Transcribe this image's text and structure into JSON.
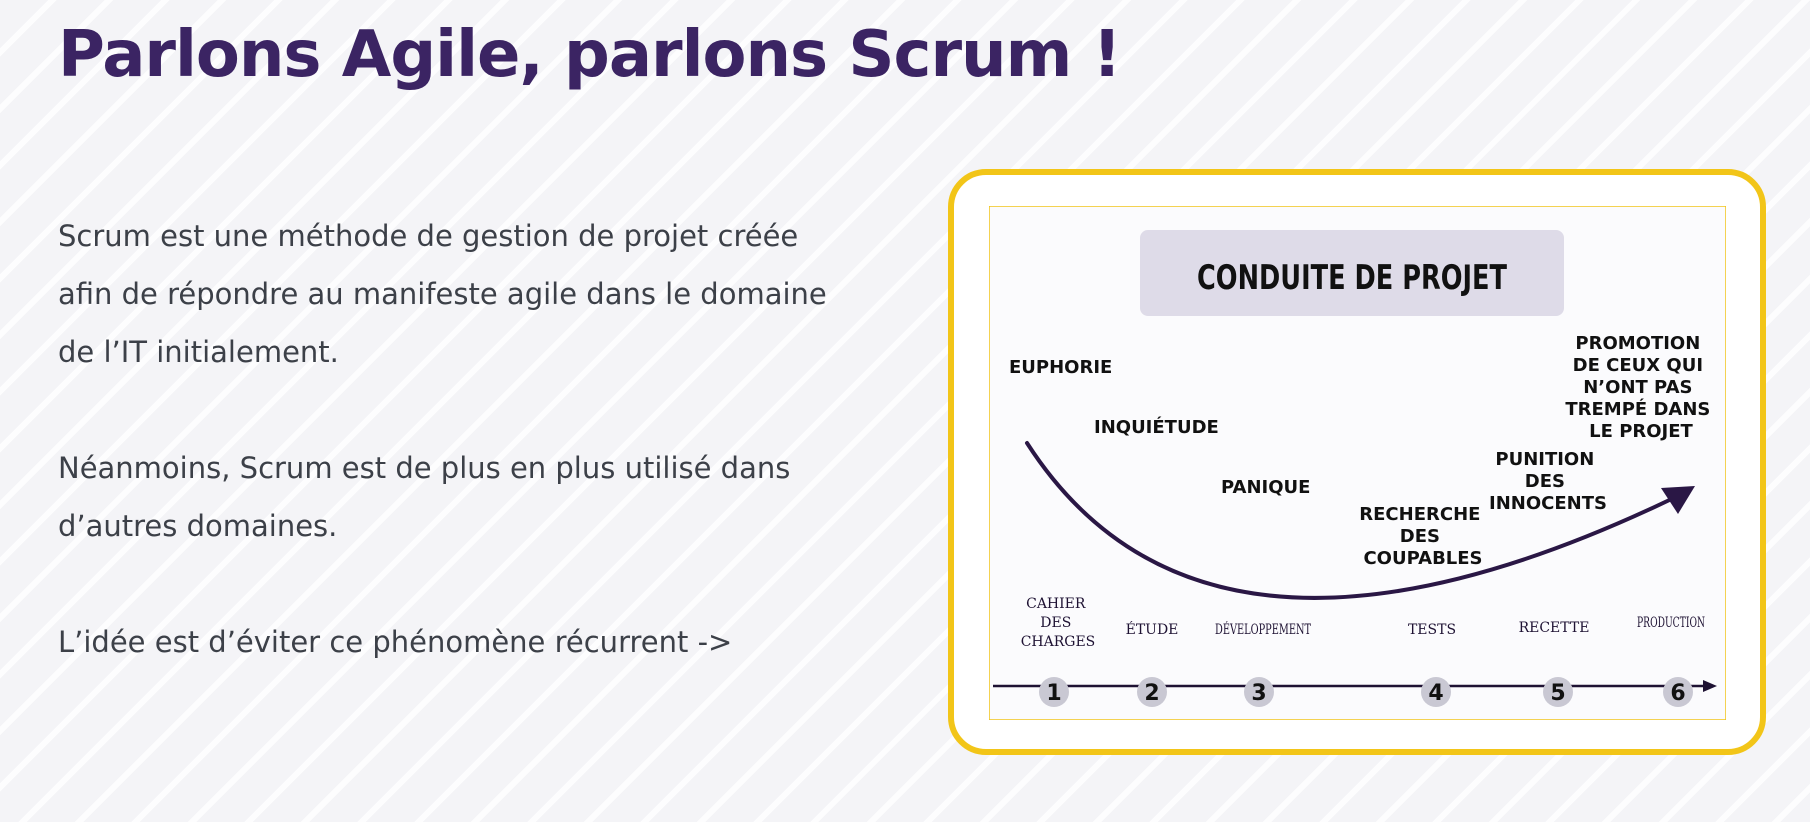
{
  "slide": {
    "title": "Parlons Agile, parlons Scrum !",
    "paragraphs": [
      {
        "lines": [
          "Scrum est une méthode de gestion de  projet créée",
          "afin de répondre au manifeste  agile dans le domaine",
          "de l’IT initialement."
        ]
      },
      {
        "lines": [
          "Néanmoins, Scrum est de plus en plus utilisé  dans",
          "d’autres domaines."
        ]
      },
      {
        "lines": [
          "L’idée est d’éviter ce phénomène récurrent ->"
        ]
      }
    ]
  },
  "diagram": {
    "title": "CONDUITE DE PROJET",
    "moods": [
      {
        "lines": [
          "EUPHORIE"
        ]
      },
      {
        "lines": [
          "INQUIÉTUDE"
        ]
      },
      {
        "lines": [
          "PANIQUE"
        ]
      },
      {
        "lines": [
          "RECHERCHE",
          "DES",
          "COUPABLES"
        ]
      },
      {
        "lines": [
          "PUNITION",
          "DES",
          "INNOCENTS"
        ]
      },
      {
        "lines": [
          "PROMOTION",
          "DE CEUX QUI",
          "N’ONT PAS",
          "TREMPÉ DANS",
          "LE PROJET"
        ]
      }
    ],
    "phases": [
      {
        "lines": [
          "CAHIER",
          "DES",
          "CHARGES"
        ]
      },
      {
        "lines": [
          "ÉTUDE"
        ]
      },
      {
        "lines": [
          "DÉVELOPPEMENT"
        ]
      },
      {
        "lines": [
          "TESTS"
        ]
      },
      {
        "lines": [
          "RECETTE"
        ]
      },
      {
        "lines": [
          "PRODUCTION"
        ]
      }
    ],
    "steps": [
      "1",
      "2",
      "3",
      "4",
      "5",
      "6"
    ]
  },
  "colors": {
    "title": "#3b2463",
    "body_text": "#3c4048",
    "frame_border": "#f2c518",
    "diagram_title_box": "#dedbe8",
    "diagram_ink": "#1e1233",
    "step_circle": "#c9c8d3"
  }
}
